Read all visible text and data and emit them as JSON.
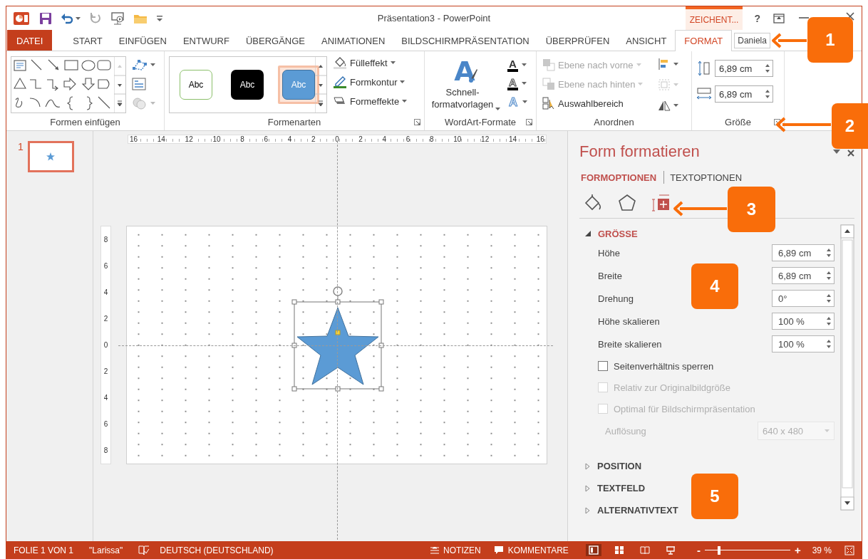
{
  "title_bar": {
    "title": "Präsentation3 - PowerPoint",
    "context_tab": "ZEICHENT...",
    "help": "?"
  },
  "tabs": [
    {
      "label": "DATEI",
      "kind": "file",
      "selected": false
    },
    {
      "label": "START",
      "kind": "tab",
      "selected": false
    },
    {
      "label": "EINFÜGEN",
      "kind": "tab",
      "selected": false
    },
    {
      "label": "ENTWURF",
      "kind": "tab",
      "selected": false
    },
    {
      "label": "ÜBERGÄNGE",
      "kind": "tab",
      "selected": false
    },
    {
      "label": "ANIMATIONEN",
      "kind": "tab",
      "selected": false
    },
    {
      "label": "BILDSCHIRMPRÄSENTATION",
      "kind": "tab",
      "selected": false
    },
    {
      "label": "ÜBERPRÜFEN",
      "kind": "tab",
      "selected": false
    },
    {
      "label": "ANSICHT",
      "kind": "tab",
      "selected": false
    },
    {
      "label": "FORMAT",
      "kind": "tab",
      "selected": true
    }
  ],
  "user_name": "Daniela",
  "ribbon": {
    "groups": [
      {
        "kind": "insert_shapes",
        "label": "Formen einfügen",
        "launcher": false
      },
      {
        "kind": "shape_styles",
        "label": "Formenarten",
        "launcher": true,
        "styles": [
          {
            "label": "Abc",
            "kind": "outline",
            "selected": false
          },
          {
            "label": "Abc",
            "kind": "dark",
            "selected": false
          },
          {
            "label": "Abc",
            "kind": "blue",
            "selected": true
          }
        ],
        "buttons": [
          {
            "kind": "fill",
            "label": "Fülleffekt"
          },
          {
            "kind": "outline",
            "label": "Formkontur"
          },
          {
            "kind": "effects",
            "label": "Formeffekte"
          }
        ]
      },
      {
        "kind": "wordart",
        "label": "WordArt-Formate",
        "launcher": true,
        "quick_styles": {
          "glyph": "A",
          "label": "Schnell-\nformatvorlagen"
        },
        "text_buttons": [
          {
            "kind": "fill",
            "glyph": "A"
          },
          {
            "kind": "outline",
            "glyph": "A"
          },
          {
            "kind": "effects",
            "glyph": "A"
          }
        ]
      },
      {
        "kind": "arrange",
        "label": "Anordnen",
        "launcher": false,
        "buttons": [
          {
            "kind": "forward",
            "label": "Ebene nach vorne",
            "disabled": true
          },
          {
            "kind": "backward",
            "label": "Ebene nach hinten",
            "disabled": true
          },
          {
            "kind": "selection",
            "label": "Auswahlbereich",
            "disabled": false
          }
        ],
        "small_buttons": [
          {
            "kind": "align",
            "disabled": false
          },
          {
            "kind": "group",
            "disabled": true
          },
          {
            "kind": "rotate",
            "disabled": false
          }
        ]
      },
      {
        "kind": "size",
        "label": "Größe",
        "launcher": true,
        "fields": [
          {
            "kind": "height",
            "value": "6,89 cm"
          },
          {
            "kind": "width",
            "value": "6,89 cm"
          }
        ]
      }
    ]
  },
  "slides": [
    {
      "number": "1",
      "selected": true
    }
  ],
  "rulers": {
    "horizontal": [
      "16",
      "14",
      "12",
      "10",
      "8",
      "6",
      "4",
      "2",
      "0",
      "2",
      "4",
      "6",
      "8",
      "10",
      "12",
      "14",
      "16"
    ],
    "vertical": [
      "8",
      "6",
      "4",
      "2",
      "0",
      "2",
      "4",
      "6",
      "8"
    ]
  },
  "format_pane": {
    "title": "Form formatieren",
    "tabs": [
      {
        "label": "FORMOPTIONEN",
        "selected": true
      },
      {
        "label": "TEXTOPTIONEN",
        "selected": false
      }
    ],
    "category_icons": [
      {
        "kind": "fill",
        "selected": false
      },
      {
        "kind": "effects",
        "selected": false
      },
      {
        "kind": "size",
        "selected": true
      }
    ],
    "sections": [
      {
        "title": "GRÖSSE",
        "expanded": true,
        "items": [
          {
            "kind": "spin",
            "label": "Höhe",
            "value": "6,89 cm"
          },
          {
            "kind": "spin",
            "label": "Breite",
            "value": "6,89 cm"
          },
          {
            "kind": "spin",
            "label": "Drehung",
            "value": "0°"
          },
          {
            "kind": "spin",
            "label": "Höhe skalieren",
            "value": "100 %"
          },
          {
            "kind": "spin",
            "label": "Breite skalieren",
            "value": "100 %"
          },
          {
            "kind": "checkbox",
            "label": "Seitenverhältnis sperren",
            "checked": false,
            "disabled": false
          },
          {
            "kind": "checkbox",
            "label": "Relativ zur Originalbildgröße",
            "checked": false,
            "disabled": true
          },
          {
            "kind": "checkbox",
            "label": "Optimal für Bildschirmpräsentation",
            "checked": false,
            "disabled": true
          },
          {
            "kind": "dropdown",
            "label": "Auflösung",
            "value": "640 x 480",
            "disabled": true
          }
        ]
      },
      {
        "title": "POSITION",
        "expanded": false
      },
      {
        "title": "TEXTFELD",
        "expanded": false
      },
      {
        "title": "ALTERNATIVTEXT",
        "expanded": false
      }
    ]
  },
  "status_bar": {
    "slide": "FOLIE 1 VON 1",
    "theme": "\"Larissa\"",
    "language": "DEUTSCH (DEUTSCHLAND)",
    "notes": "NOTIZEN",
    "comments": "KOMMENTARE",
    "views": [
      {
        "kind": "normal",
        "selected": true
      },
      {
        "kind": "sorter",
        "selected": false
      },
      {
        "kind": "reading",
        "selected": false
      },
      {
        "kind": "slideshow",
        "selected": false
      }
    ],
    "zoom_out": "-",
    "zoom": {
      "level": 0.17
    },
    "zoom_in": "+",
    "zoom_reading": "39 %"
  },
  "callouts": [
    {
      "label": "1"
    },
    {
      "label": "2"
    },
    {
      "label": "3"
    },
    {
      "label": "4"
    },
    {
      "label": "5"
    }
  ]
}
